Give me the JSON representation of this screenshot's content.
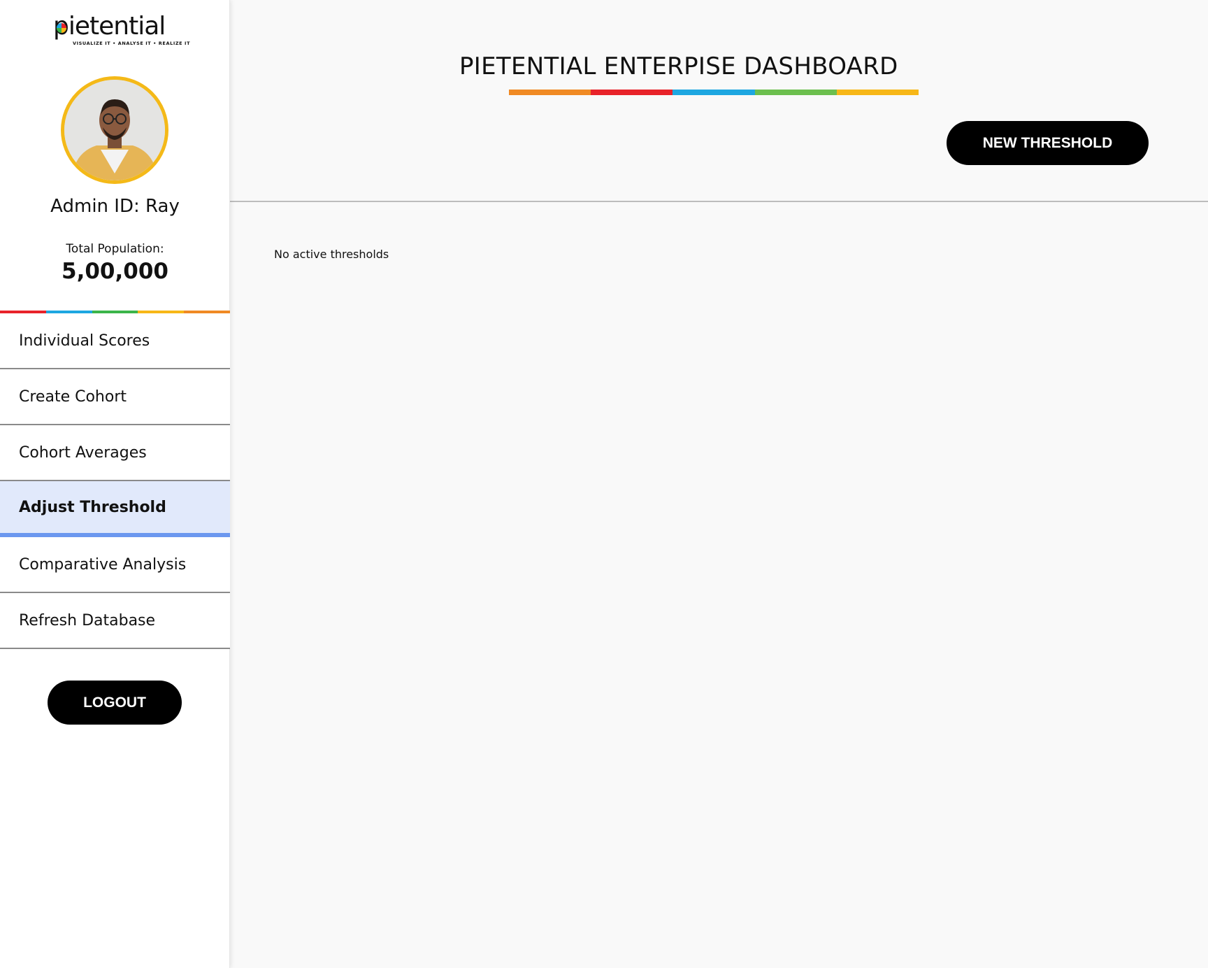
{
  "brand": {
    "logo_text": "pietential",
    "tagline": "VISUALIZE IT • ANALYSE IT • REALIZE IT"
  },
  "profile": {
    "admin_label": "Admin ID: Ray",
    "population_label": "Total Population:",
    "population_value": "5,00,000",
    "avatar_ring_color": "#f4b918"
  },
  "colors": {
    "sidebar_strip": [
      "#e8232a",
      "#1ea7e1",
      "#3bb54a",
      "#f7b718",
      "#f08a24"
    ],
    "title_bar": [
      "#f08a24",
      "#e8232a",
      "#1ea7e1",
      "#6cbf4e",
      "#f7b718"
    ],
    "active_nav_bg": "#e1e9fb",
    "active_nav_accent": "#6b97ef"
  },
  "nav": {
    "items": [
      {
        "label": "Individual Scores",
        "active": false
      },
      {
        "label": "Create Cohort",
        "active": false
      },
      {
        "label": "Cohort Averages",
        "active": false
      },
      {
        "label": "Adjust Threshold",
        "active": true
      },
      {
        "label": "Comparative Analysis",
        "active": false
      },
      {
        "label": "Refresh Database",
        "active": false
      }
    ]
  },
  "logout_label": "LOGOUT",
  "header": {
    "title": "PIETENTIAL ENTERPISE DASHBOARD",
    "new_threshold_label": "NEW THRESHOLD"
  },
  "content": {
    "empty_message": "No active thresholds"
  }
}
